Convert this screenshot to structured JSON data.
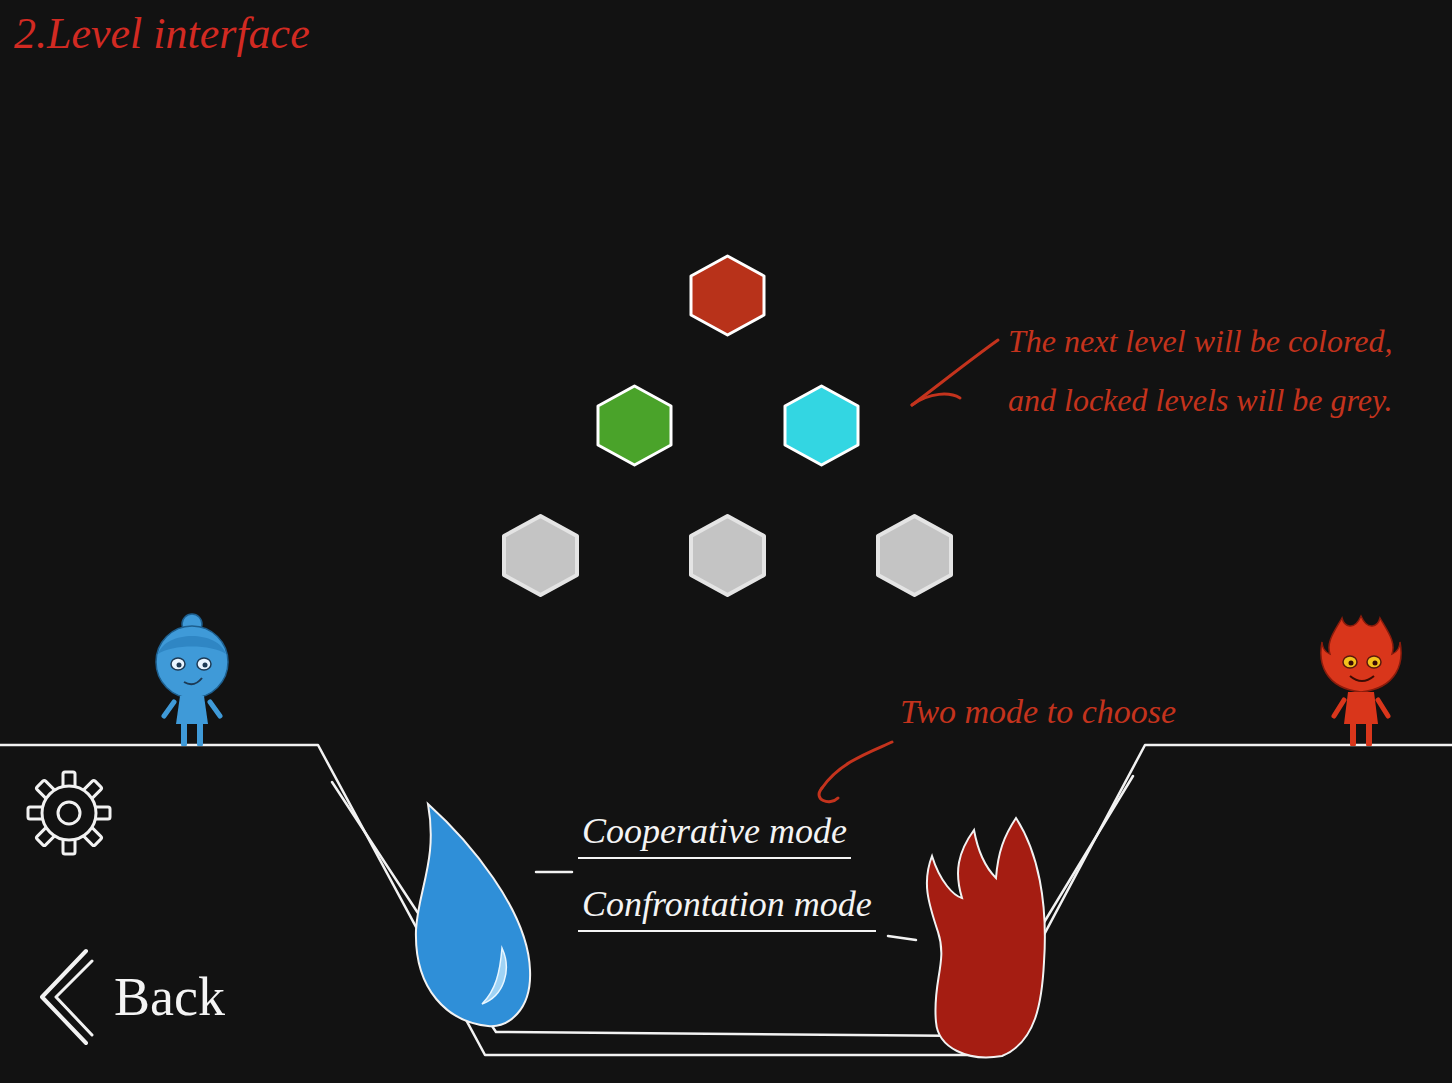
{
  "title": "2.Level interface",
  "levels": [
    {
      "color": "#b8321a",
      "locked": false
    },
    {
      "color": "#4aa32a",
      "locked": false
    },
    {
      "color": "#33d6e2",
      "locked": false
    },
    {
      "color": "#c4c4c4",
      "locked": true
    },
    {
      "color": "#c4c4c4",
      "locked": true
    },
    {
      "color": "#c4c4c4",
      "locked": true
    }
  ],
  "levels_note": "The next level will be colored, and locked levels will be grey.",
  "modes": {
    "note": "Two mode to choose",
    "items": [
      {
        "label": "Cooperative mode"
      },
      {
        "label": "Confrontation mode"
      }
    ]
  },
  "back": "Back"
}
